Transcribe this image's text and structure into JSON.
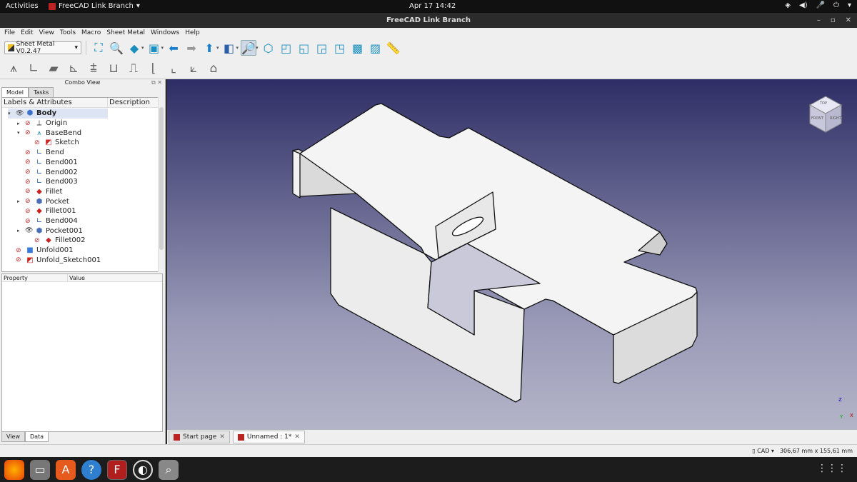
{
  "topbar": {
    "activities": "Activities",
    "app_name": "FreeCAD Link Branch",
    "app_caret": "▾",
    "clock": "Apr 17  14:42",
    "tray_icons": [
      "network-icon",
      "volume-icon",
      "mic-icon",
      "power-icon"
    ]
  },
  "window": {
    "title": "FreeCAD Link Branch",
    "controls": [
      "–",
      "▫",
      "✕"
    ]
  },
  "menu": [
    "File",
    "Edit",
    "View",
    "Tools",
    "Macro",
    "Sheet Metal",
    "Windows",
    "Help"
  ],
  "toolbar": {
    "workbench": "Sheet Metal V0.2.47",
    "workbench_caret": "▾"
  },
  "combo": {
    "title": "Combo View",
    "controls": "⧉ ✕",
    "tabs": [
      "Model",
      "Tasks"
    ],
    "tree_header": {
      "col1": "Labels & Attributes",
      "col2": "Description"
    },
    "items": [
      {
        "label": "Body",
        "indent": 0,
        "expand": "▾",
        "bold": true,
        "eye": "open",
        "icon": "body-icon"
      },
      {
        "label": "Origin",
        "indent": 1,
        "expand": "▸",
        "bold": false,
        "eye": "hidden",
        "icon": "origin-icon"
      },
      {
        "label": "BaseBend",
        "indent": 1,
        "expand": "▾",
        "bold": false,
        "eye": "hidden",
        "icon": "basebend-icon"
      },
      {
        "label": "Sketch",
        "indent": 2,
        "expand": "",
        "bold": false,
        "eye": "hidden",
        "icon": "sketch-icon"
      },
      {
        "label": "Bend",
        "indent": 1,
        "expand": "",
        "bold": false,
        "eye": "hidden",
        "icon": "bend-icon"
      },
      {
        "label": "Bend001",
        "indent": 1,
        "expand": "",
        "bold": false,
        "eye": "hidden",
        "icon": "bend-icon"
      },
      {
        "label": "Bend002",
        "indent": 1,
        "expand": "",
        "bold": false,
        "eye": "hidden",
        "icon": "bend-icon"
      },
      {
        "label": "Bend003",
        "indent": 1,
        "expand": "",
        "bold": false,
        "eye": "hidden",
        "icon": "bend-icon"
      },
      {
        "label": "Fillet",
        "indent": 1,
        "expand": "",
        "bold": false,
        "eye": "hidden",
        "icon": "fillet-icon"
      },
      {
        "label": "Pocket",
        "indent": 1,
        "expand": "▸",
        "bold": false,
        "eye": "hidden",
        "icon": "pocket-icon"
      },
      {
        "label": "Fillet001",
        "indent": 1,
        "expand": "",
        "bold": false,
        "eye": "hidden",
        "icon": "fillet-icon"
      },
      {
        "label": "Bend004",
        "indent": 1,
        "expand": "",
        "bold": false,
        "eye": "hidden",
        "icon": "bend-icon"
      },
      {
        "label": "Pocket001",
        "indent": 1,
        "expand": "▸",
        "bold": false,
        "eye": "open",
        "icon": "pocket-icon"
      },
      {
        "label": "Fillet002",
        "indent": 2,
        "expand": "",
        "bold": false,
        "eye": "hidden",
        "icon": "fillet-icon"
      },
      {
        "label": "Unfold001",
        "indent": 0,
        "expand": "",
        "bold": false,
        "eye": "hidden",
        "icon": "unfold-icon"
      },
      {
        "label": "Unfold_Sketch001",
        "indent": 0,
        "expand": "",
        "bold": false,
        "eye": "hidden",
        "icon": "sketch-icon"
      }
    ],
    "props_header": {
      "col1": "Property",
      "col2": "Value"
    },
    "prop_tabs": [
      "View",
      "Data"
    ]
  },
  "doc_tabs": [
    {
      "label": "Start page",
      "close": "✕"
    },
    {
      "label": "Unnamed : 1*",
      "close": "✕"
    }
  ],
  "navcube": {
    "front": "FRONT",
    "top": "TOP",
    "right": "RIGHT"
  },
  "axes": {
    "z": "Z",
    "x": "X",
    "y": "Y"
  },
  "status": {
    "nav_style": "CAD",
    "nav_caret": "▾",
    "dimensions": "306,67 mm x 155,61 mm"
  },
  "colors": {
    "accent": "#1a8fbf",
    "part_fill": "#e6e6e6",
    "part_edge": "#111111",
    "bg_top": "#2e2e66",
    "bg_bottom": "#b4b4c8"
  }
}
